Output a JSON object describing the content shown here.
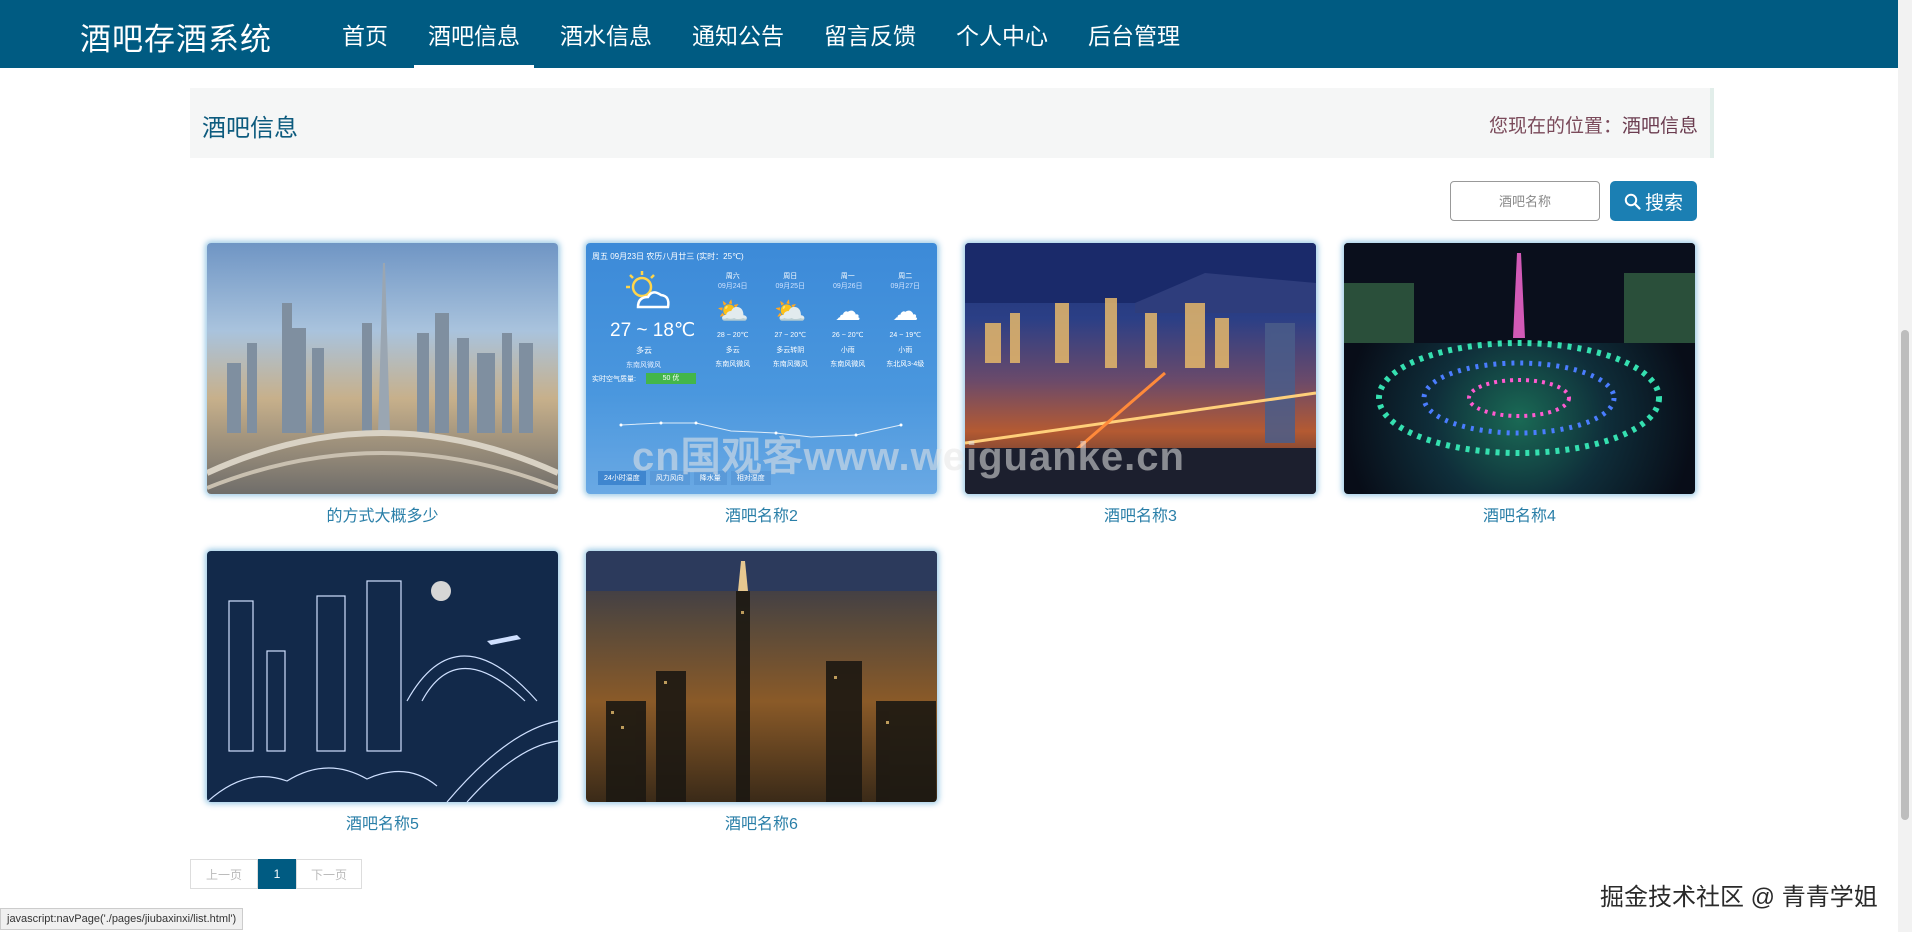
{
  "brand": "酒吧存酒系统",
  "nav": {
    "items": [
      {
        "label": "首页"
      },
      {
        "label": "酒吧信息",
        "active": true
      },
      {
        "label": "酒水信息"
      },
      {
        "label": "通知公告"
      },
      {
        "label": "留言反馈"
      },
      {
        "label": "个人中心"
      },
      {
        "label": "后台管理"
      }
    ]
  },
  "header": {
    "title": "酒吧信息",
    "location_prefix": "您现在的位置：",
    "location_current": "酒吧信息"
  },
  "search": {
    "placeholder": "酒吧名称",
    "button_label": "搜索"
  },
  "cards": [
    {
      "caption": "的方式大概多少"
    },
    {
      "caption": "酒吧名称2"
    },
    {
      "caption": "酒吧名称3"
    },
    {
      "caption": "酒吧名称4"
    },
    {
      "caption": "酒吧名称5"
    },
    {
      "caption": "酒吧名称6"
    }
  ],
  "weather_widget": {
    "header": "周五 09月23日 农历八月廿三 (实时：25℃)",
    "today_temp": "27 ~ 18℃",
    "today_desc": "多云",
    "today_wind": "东南风微风",
    "aqi_label": "实时空气质量:",
    "aqi_value": "50 优",
    "days": [
      {
        "day": "周六",
        "date": "09月24日",
        "temp": "28 ~ 20℃",
        "desc": "多云",
        "wind": "东南风微风"
      },
      {
        "day": "周日",
        "date": "09月25日",
        "temp": "27 ~ 20℃",
        "desc": "多云转阴",
        "wind": "东南风微风"
      },
      {
        "day": "周一",
        "date": "09月26日",
        "temp": "26 ~ 20℃",
        "desc": "小雨",
        "wind": "东南风微风"
      },
      {
        "day": "周二",
        "date": "09月27日",
        "temp": "24 ~ 19℃",
        "desc": "小雨",
        "wind": "东北风3-4级"
      }
    ],
    "tabs": [
      "24小时温度",
      "风力风向",
      "降水量",
      "相对湿度"
    ]
  },
  "pager": {
    "prev": "上一页",
    "current": "1",
    "next": "下一页"
  },
  "status_bar": "javascript:navPage('./pages/jiubaxinxi/list.html')",
  "watermark": "掘金技术社区 @ 青青学姐",
  "overlay_watermark": "cn国观客www.weiguanke.cn",
  "colors": {
    "nav_bg": "#005b82",
    "accent": "#1b7fb3",
    "caption": "#2a7fa8"
  }
}
